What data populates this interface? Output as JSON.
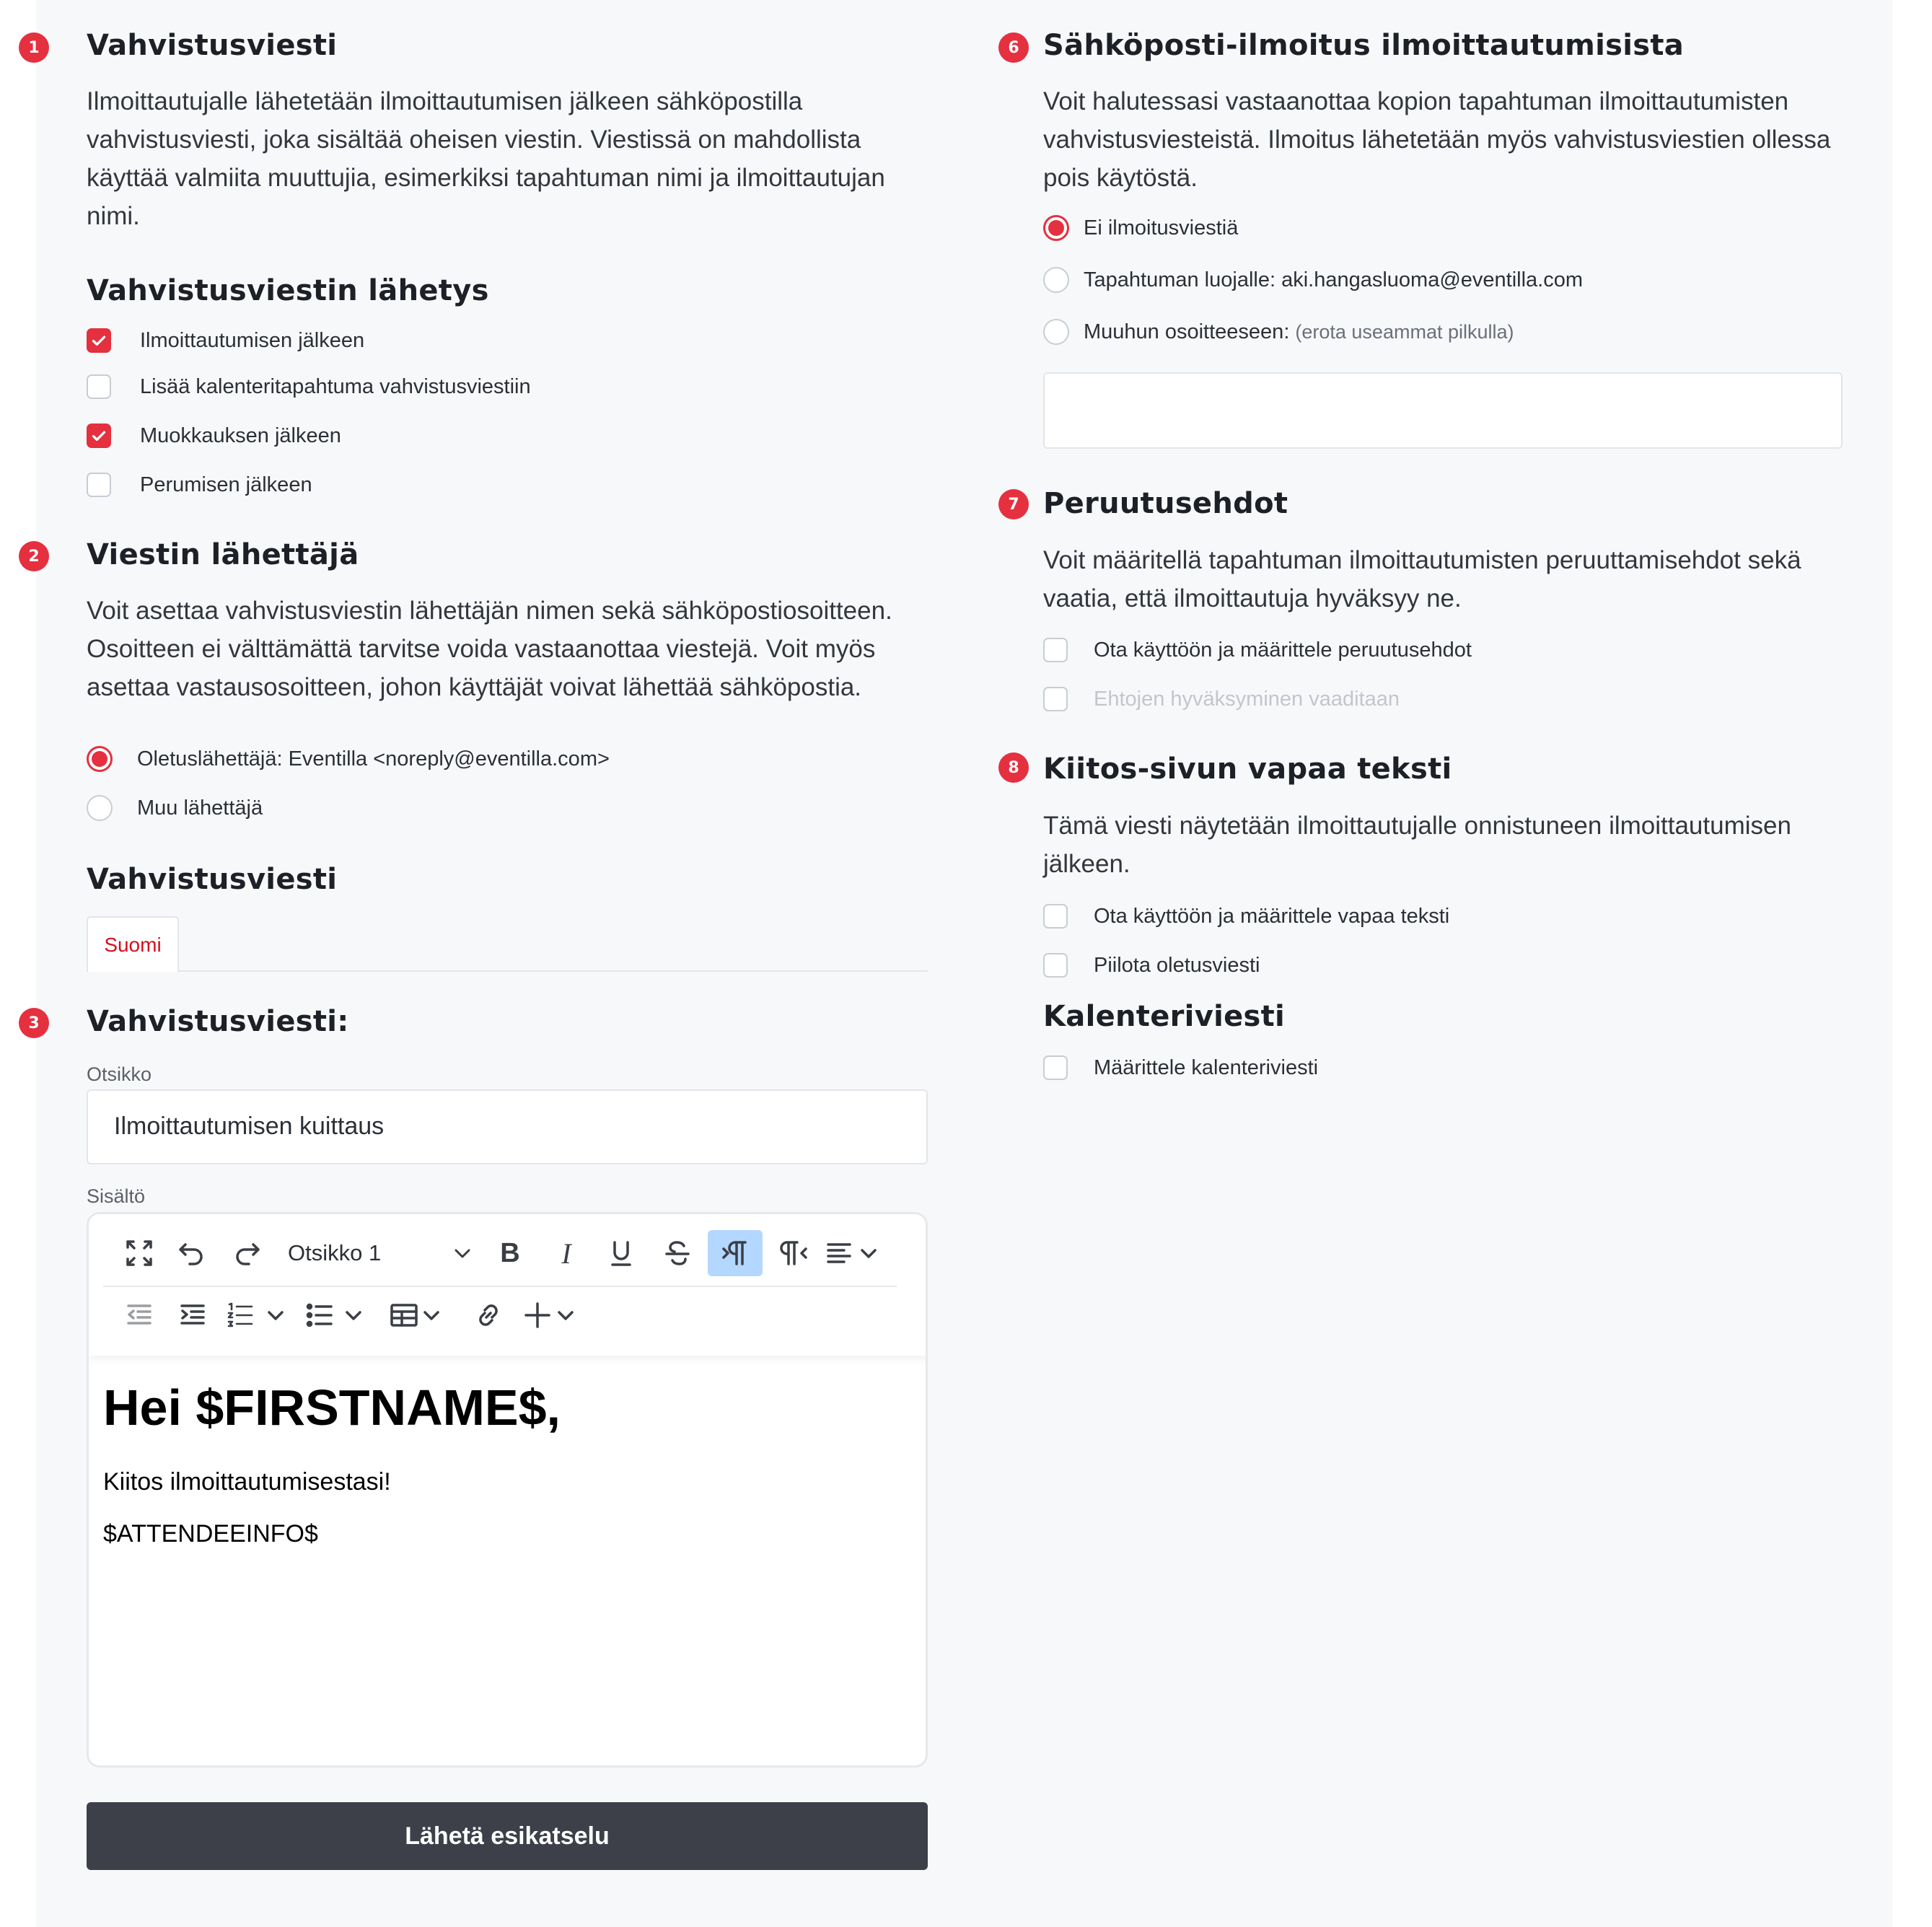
{
  "colors": {
    "accent": "#e5303f",
    "dark_button": "#3d4049",
    "panel_bg": "#f7f8fa"
  },
  "left": {
    "s1": {
      "badge": "1",
      "title": "Vahvistusviesti",
      "desc_lines": [
        "Ilmoittautujalle lähetetään ilmoittautumisen jälkeen sähköpostilla",
        "vahvistusviesti, joka sisältää oheisen viestin. Viestissä on mahdollista",
        "käyttää valmiita muuttujia, esimerkiksi tapahtuman nimi ja ilmoittautujan",
        "nimi."
      ],
      "sub_title": "Vahvistusviestin lähetys",
      "options": [
        {
          "label": "Ilmoittautumisen jälkeen",
          "checked": true
        },
        {
          "label": "Lisää kalenteritapahtuma vahvistusviestiin",
          "checked": false
        },
        {
          "label": "Muokkauksen jälkeen",
          "checked": true
        },
        {
          "label": "Perumisen jälkeen",
          "checked": false
        }
      ]
    },
    "s2": {
      "badge": "2",
      "title": "Viestin lähettäjä",
      "desc_lines": [
        "Voit asettaa vahvistusviestin lähettäjän nimen sekä sähköpostiosoitteen.",
        "Osoitteen ei välttämättä tarvitse voida vastaanottaa viestejä. Voit myös",
        "asettaa vastausosoitteen, johon käyttäjät voivat lähettää sähköpostia."
      ],
      "radios": [
        {
          "label": "Oletuslähettäjä: Eventilla <noreply@eventilla.com>",
          "checked": true
        },
        {
          "label": "Muu lähettäjä",
          "checked": false
        }
      ],
      "sub_title": "Vahvistusviesti",
      "tab_label": "Suomi"
    },
    "s3": {
      "badge": "3",
      "title": "Vahvistusviesti:",
      "subject_label": "Otsikko",
      "subject_value": "Ilmoittautumisen kuittaus",
      "content_label": "Sisältö",
      "format_select": "Otsikko 1",
      "editor": {
        "heading": "Hei $FIRSTNAME$,",
        "line1": "Kiitos ilmoittautumisestasi!",
        "line2": "$ATTENDEEINFO$"
      },
      "preview_button": "Lähetä esikatselu"
    }
  },
  "right": {
    "s6": {
      "badge": "6",
      "title": "Sähköposti-ilmoitus ilmoittautumisista",
      "desc_lines": [
        "Voit halutessasi vastaanottaa kopion tapahtuman ilmoittautumisten",
        "vahvistusviesteistä. Ilmoitus lähetetään myös vahvistusviestien ollessa",
        "pois käytöstä."
      ],
      "radios": [
        {
          "label": "Ei ilmoitusviestiä",
          "checked": true
        },
        {
          "label": "Tapahtuman luojalle: aki.hangasluoma@eventilla.com",
          "checked": false
        },
        {
          "label": "Muuhun osoitteeseen:",
          "hint": "(erota useammat pilkulla)",
          "checked": false
        }
      ]
    },
    "s7": {
      "badge": "7",
      "title": "Peruutusehdot",
      "desc_lines": [
        "Voit määritellä tapahtuman ilmoittautumisten peruuttamisehdot sekä",
        "vaatia, että ilmoittautuja hyväksyy ne."
      ],
      "options": [
        {
          "label": "Ota käyttöön ja määrittele peruutusehdot",
          "checked": false
        },
        {
          "label": "Ehtojen hyväksyminen vaaditaan",
          "checked": false,
          "disabled": true
        }
      ]
    },
    "s8": {
      "badge": "8",
      "title": "Kiitos-sivun vapaa teksti",
      "desc_lines": [
        "Tämä viesti näytetään ilmoittautujalle onnistuneen ilmoittautumisen",
        "jälkeen."
      ],
      "options": [
        {
          "label": "Ota käyttöön ja määrittele vapaa teksti",
          "checked": false
        },
        {
          "label": "Piilota oletusviesti",
          "checked": false
        }
      ],
      "sub_title": "Kalenteriviesti",
      "calendar_option": {
        "label": "Määrittele kalenteriviesti",
        "checked": false
      }
    }
  }
}
